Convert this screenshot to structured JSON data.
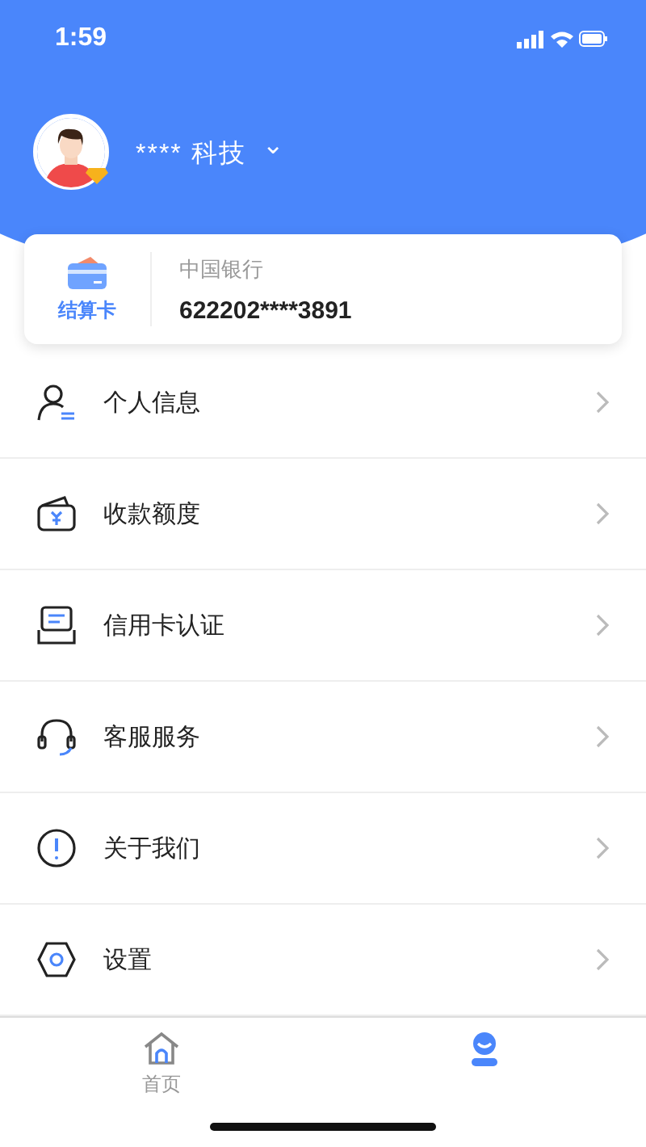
{
  "status_bar": {
    "time": "1:59"
  },
  "profile": {
    "name": "**** 科技",
    "chevron": "⌄"
  },
  "card": {
    "badge": "结算卡",
    "bank": "中国银行",
    "number": "622202****3891"
  },
  "menu": [
    {
      "kind": "person",
      "label": "个人信息"
    },
    {
      "kind": "wallet",
      "label": "收款额度"
    },
    {
      "kind": "credit",
      "label": "信用卡认证"
    },
    {
      "kind": "headset",
      "label": "客服服务"
    },
    {
      "kind": "info",
      "label": "关于我们"
    },
    {
      "kind": "settings",
      "label": "设置"
    }
  ],
  "tabs": [
    {
      "kind": "home",
      "label": "首页",
      "selected": false
    },
    {
      "kind": "me",
      "selected": true
    }
  ]
}
